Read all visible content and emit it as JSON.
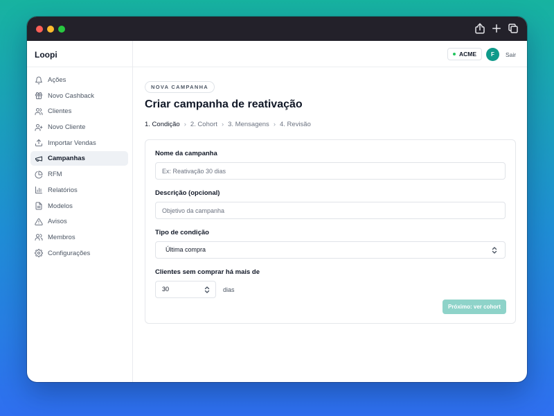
{
  "brand": {
    "name": "Loopi"
  },
  "sidebar": {
    "items": [
      {
        "label": "Ações",
        "icon": "bell-icon",
        "active": false
      },
      {
        "label": "Novo Cashback",
        "icon": "gift-icon",
        "active": false
      },
      {
        "label": "Clientes",
        "icon": "users-icon",
        "active": false
      },
      {
        "label": "Novo Cliente",
        "icon": "user-plus-icon",
        "active": false
      },
      {
        "label": "Importar Vendas",
        "icon": "upload-icon",
        "active": false
      },
      {
        "label": "Campanhas",
        "icon": "megaphone-icon",
        "active": true
      },
      {
        "label": "RFM",
        "icon": "pie-chart-icon",
        "active": false
      },
      {
        "label": "Relatórios",
        "icon": "bar-chart-icon",
        "active": false
      },
      {
        "label": "Modelos",
        "icon": "file-text-icon",
        "active": false
      },
      {
        "label": "Avisos",
        "icon": "alert-triangle-icon",
        "active": false
      },
      {
        "label": "Membros",
        "icon": "members-icon",
        "active": false
      },
      {
        "label": "Configurações",
        "icon": "gear-icon",
        "active": false
      }
    ]
  },
  "topbar": {
    "org": "ACME",
    "org_status_color": "#22c55e",
    "avatar_initial": "F",
    "avatar_color": "#0f9a8a",
    "logout": "Sair"
  },
  "page": {
    "pill": "NOVA CAMPANHA",
    "title": "Criar campanha de reativação",
    "steps": [
      "1. Condição",
      "2. Cohort",
      "3. Mensagens",
      "4. Revisão"
    ],
    "step_separator": "›"
  },
  "form": {
    "name_label": "Nome da campanha",
    "name_placeholder": "Ex: Reativação 30 dias",
    "description_label": "Descrição (opcional)",
    "description_placeholder": "Objetivo da campanha",
    "condition_label": "Tipo de condição",
    "condition_value": "Última compra",
    "days_label": "Clientes sem comprar há mais de",
    "days_value": "30",
    "days_unit": "dias",
    "next_button": "Próximo: ver cohort",
    "next_button_color": "#8ed3c9"
  }
}
